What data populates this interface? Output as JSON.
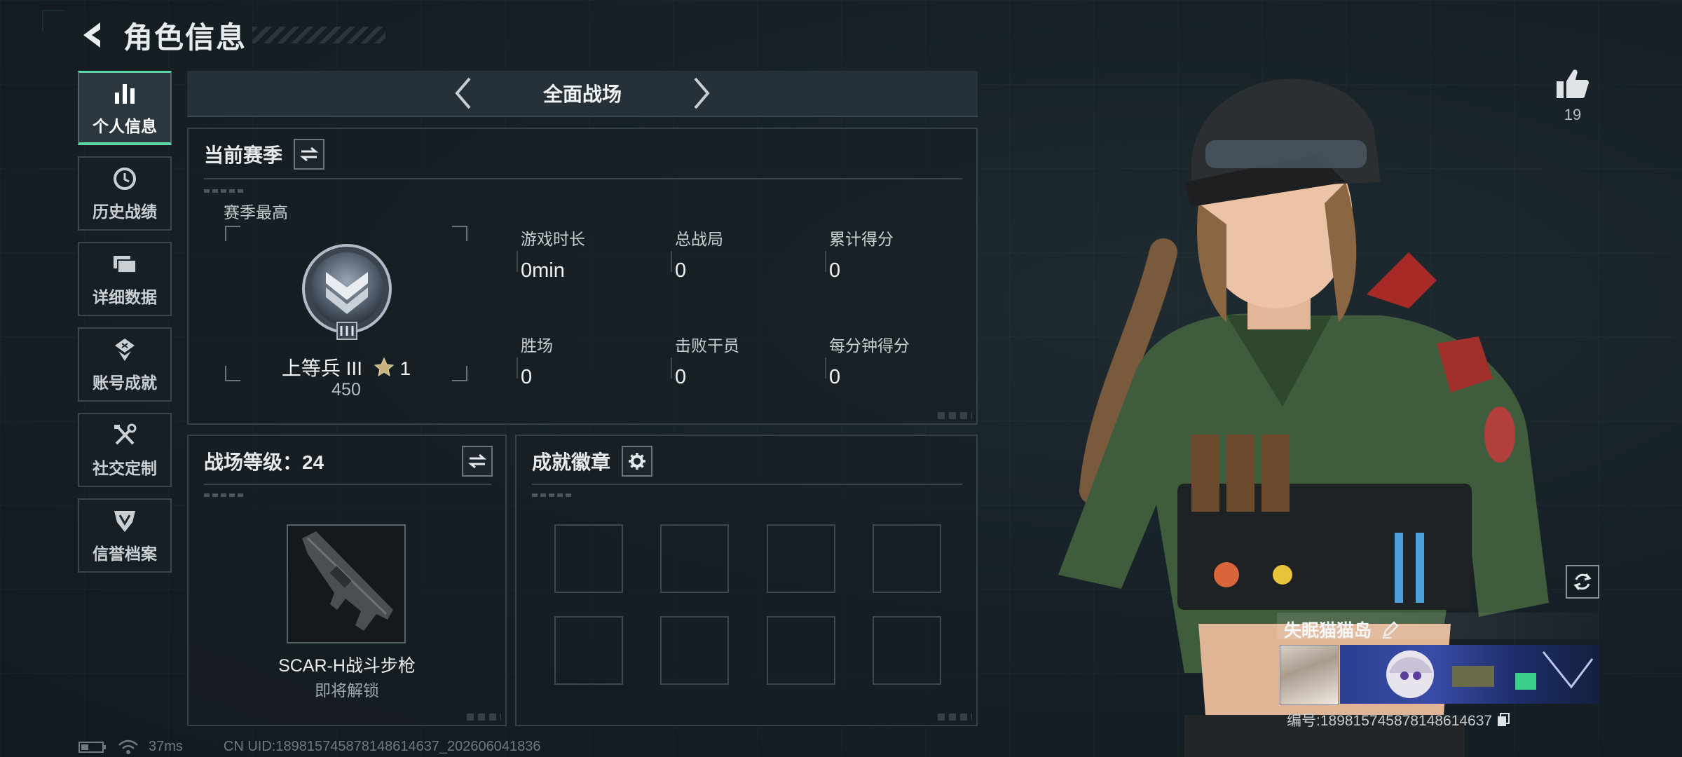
{
  "header": {
    "title": "角色信息"
  },
  "sidebar": {
    "items": [
      {
        "label": "个人信息",
        "icon": "bar-chart-icon",
        "active": true
      },
      {
        "label": "历史战绩",
        "icon": "clock-history-icon",
        "active": false
      },
      {
        "label": "详细数据",
        "icon": "folder-icon",
        "active": false
      },
      {
        "label": "账号成就",
        "icon": "achievement-icon",
        "active": false
      },
      {
        "label": "社交定制",
        "icon": "tools-icon",
        "active": false
      },
      {
        "label": "信誉档案",
        "icon": "shield-badge-icon",
        "active": false
      }
    ]
  },
  "mode": {
    "name": "全面战场"
  },
  "season": {
    "title": "当前赛季",
    "best_label": "赛季最高",
    "rank_name": "上等兵 III",
    "rank_stars": "1",
    "rank_points": "450",
    "stats": [
      {
        "label": "游戏时长",
        "value": "0min"
      },
      {
        "label": "总战局",
        "value": "0"
      },
      {
        "label": "累计得分",
        "value": "0"
      },
      {
        "label": "胜场",
        "value": "0"
      },
      {
        "label": "击败干员",
        "value": "0"
      },
      {
        "label": "每分钟得分",
        "value": "0"
      }
    ]
  },
  "level": {
    "title": "战场等级：24",
    "weapon_name": "SCAR-H战斗步枪",
    "weapon_status": "即将解锁"
  },
  "badges": {
    "title": "成就徽章",
    "slots": 8
  },
  "profile": {
    "likes": "19",
    "nickname": "失眠猫猫岛",
    "id_line": "编号:18981574587814861463​7"
  },
  "status": {
    "ping": "37ms",
    "uid": "CN UID:18981574587814861463​7_202606041836"
  },
  "colors": {
    "accent": "#5cd6a6",
    "panel_border": "#343f47"
  }
}
